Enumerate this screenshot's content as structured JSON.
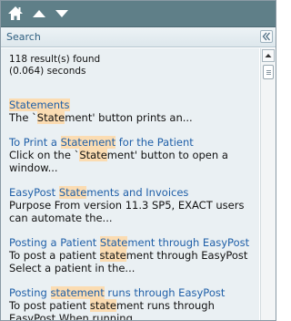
{
  "nav": {
    "icons": [
      "home-icon",
      "arrow-up-icon",
      "arrow-down-icon"
    ],
    "bar_color": "#5f7f88"
  },
  "search": {
    "title": "Search",
    "collapse_icon": "double-chevron-left-icon"
  },
  "summary": {
    "count_line": "118 result(s) found",
    "time_line": "(0.064) seconds"
  },
  "results": [
    {
      "title": [
        {
          "t": "Statements",
          "hl": true
        }
      ],
      "snippet": [
        {
          "t": "The `"
        },
        {
          "t": "State",
          "hl": true
        },
        {
          "t": "ment' button prints an..."
        }
      ]
    },
    {
      "title": [
        {
          "t": "To Print a "
        },
        {
          "t": "Statement",
          "hl": true
        },
        {
          "t": " for the Patient"
        }
      ],
      "snippet": [
        {
          "t": "Click on the `"
        },
        {
          "t": "State",
          "hl": true
        },
        {
          "t": "ment' button to open a"
        }
      ],
      "snippet2": [
        {
          "t": "window..."
        }
      ]
    },
    {
      "title": [
        {
          "t": "EasyPost "
        },
        {
          "t": "State",
          "hl": true
        },
        {
          "t": "ments and Invoices"
        }
      ],
      "snippet": [
        {
          "t": "Purpose From version 11.3 SP5, EXACT users"
        }
      ],
      "snippet2": [
        {
          "t": "can automate the..."
        }
      ]
    },
    {
      "title": [
        {
          "t": "Posting a Patient "
        },
        {
          "t": "State",
          "hl": true
        },
        {
          "t": "ment through EasyPost"
        }
      ],
      "snippet": [
        {
          "t": "To post a patient "
        },
        {
          "t": "state",
          "hl": true
        },
        {
          "t": "ment through EasyPost"
        }
      ],
      "snippet2": [
        {
          "t": "Select a patient in the..."
        }
      ]
    },
    {
      "title": [
        {
          "t": "Posting "
        },
        {
          "t": "statement",
          "hl": true
        },
        {
          "t": " runs through EasyPost"
        }
      ],
      "snippet": [
        {
          "t": "To post patient "
        },
        {
          "t": "state",
          "hl": true
        },
        {
          "t": "ment runs through"
        }
      ],
      "snippet2": [
        {
          "t": "EasyPost When running..."
        }
      ]
    }
  ],
  "colors": {
    "link": "#1f5fa8",
    "highlight": "#fbdcb2",
    "panel_bg": "#eaf0f3"
  }
}
